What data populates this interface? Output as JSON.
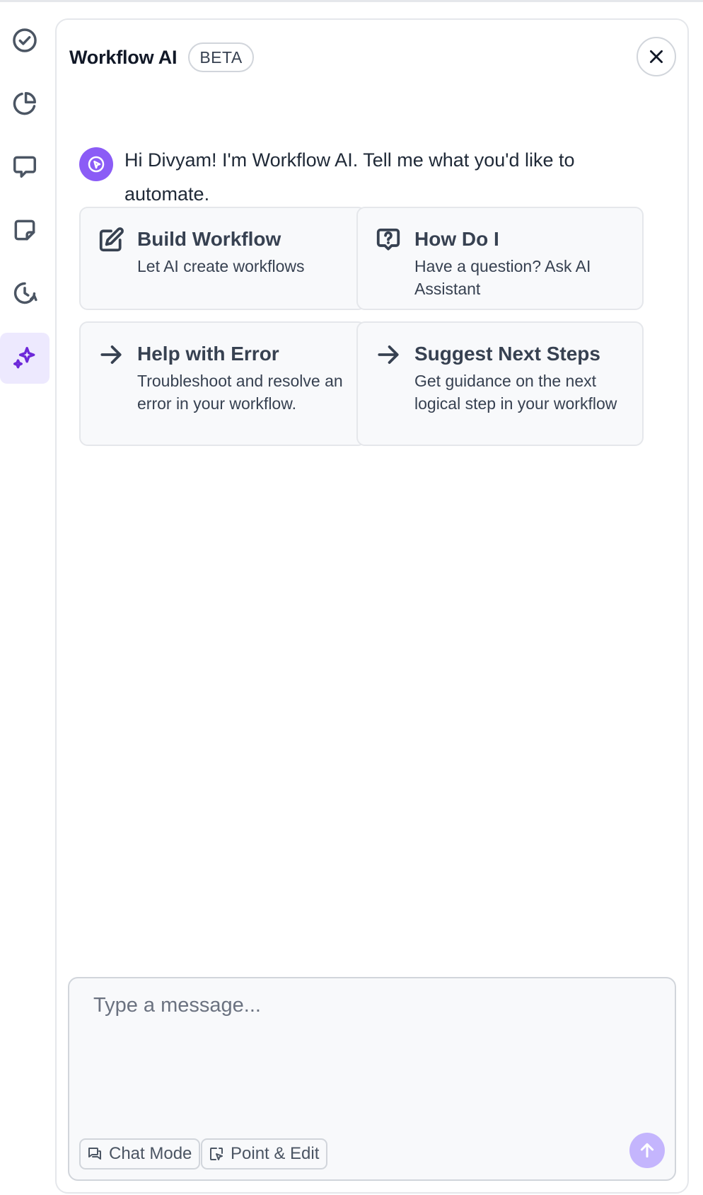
{
  "panel": {
    "title": "Workflow AI",
    "badge": "BETA"
  },
  "rail": {
    "items": [
      {
        "icon": "check-circle-icon",
        "active": false
      },
      {
        "icon": "pie-chart-icon",
        "active": false
      },
      {
        "icon": "chat-bubble-icon",
        "active": false
      },
      {
        "icon": "sticky-note-icon",
        "active": false
      },
      {
        "icon": "history-icon",
        "active": false
      },
      {
        "icon": "sparkles-icon",
        "active": true
      }
    ]
  },
  "greeting": {
    "text": "Hi Divyam! I'm Workflow AI. Tell me what you'd like to automate."
  },
  "cards": [
    {
      "icon": "edit-icon",
      "title": "Build Workflow",
      "description": "Let AI create workflows"
    },
    {
      "icon": "question-bubble-icon",
      "title": "How Do I",
      "description": "Have a question? Ask AI Assistant"
    },
    {
      "icon": "arrow-right-icon",
      "title": "Help with Error",
      "description": "Troubleshoot and resolve an error in your workflow."
    },
    {
      "icon": "arrow-right-icon",
      "title": "Suggest Next Steps",
      "description": "Get guidance on the next logical step in your workflow"
    }
  ],
  "composer": {
    "placeholder": "Type a message...",
    "value": "",
    "chat_mode_label": "Chat Mode",
    "point_edit_label": "Point & Edit"
  },
  "colors": {
    "accent": "#8b5cf6",
    "accent_light": "#ede9fe",
    "send_button": "#c4b5fd"
  }
}
